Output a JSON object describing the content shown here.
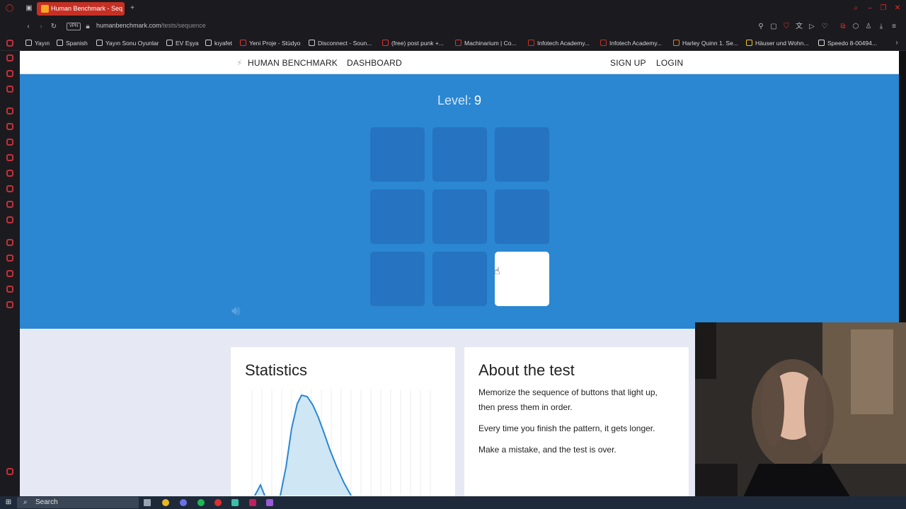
{
  "browser": {
    "tab_title": "Human Benchmark - Seq",
    "url_host": "humanbenchmark.com",
    "url_path": "/tests/sequence",
    "vpn_label": "VPN",
    "bookmarks": [
      {
        "label": "Yayın",
        "color": "#cfcfd4"
      },
      {
        "label": "Spanish",
        "color": "#cfcfd4"
      },
      {
        "label": "Yayın Sonu Oyunlar",
        "color": "#cfcfd4"
      },
      {
        "label": "EV Eşya",
        "color": "#cfcfd4"
      },
      {
        "label": "kıyafet",
        "color": "#cfcfd4"
      },
      {
        "label": "Yeni Proje - Stüdyo",
        "color": "#e0302c"
      },
      {
        "label": "Disconnect - Soun...",
        "color": "#cfcfd4"
      },
      {
        "label": "(free) post punk +...",
        "color": "#e0302c"
      },
      {
        "label": "Machinarium | Co...",
        "color": "#e0302c"
      },
      {
        "label": "Infotech Academy...",
        "color": "#c63024"
      },
      {
        "label": "Infotech Academy...",
        "color": "#c63024"
      },
      {
        "label": "Harley Quinn 1. Se...",
        "color": "#e07a2c"
      },
      {
        "label": "Häuser und Wohn...",
        "color": "#f0c419"
      },
      {
        "label": "Speedo 8-00494...",
        "color": "#e0e0e0"
      }
    ]
  },
  "nav": {
    "brand": "HUMAN BENCHMARK",
    "dashboard": "DASHBOARD",
    "signup": "SIGN UP",
    "login": "LOGIN"
  },
  "game": {
    "level_label": "Level:",
    "level_value": "9",
    "lit_cell_index": 8,
    "colors": {
      "hero": "#2b87d1",
      "cell": "#2573c1",
      "lit": "#ffffff"
    }
  },
  "statistics": {
    "title": "Statistics"
  },
  "about": {
    "title": "About the test",
    "paragraphs": [
      "Memorize the sequence of buttons that light up, then press them in order.",
      "Every time you finish the pattern, it gets longer.",
      "Make a mistake, and the test is over."
    ]
  },
  "taskbar": {
    "search_label": "Search"
  }
}
